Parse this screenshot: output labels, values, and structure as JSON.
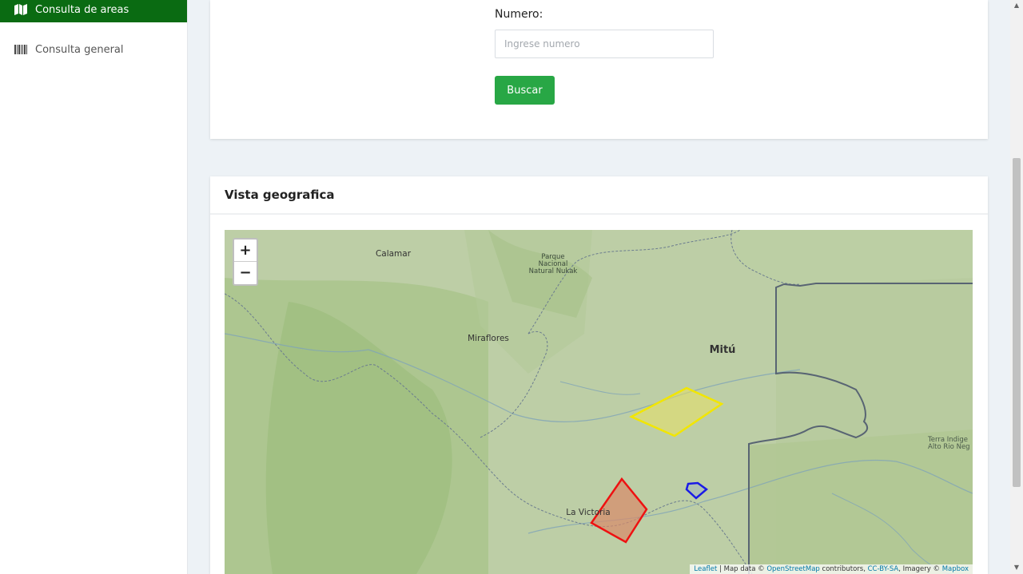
{
  "sidebar": {
    "items": [
      {
        "label": "Consulta de areas",
        "icon": "map-icon",
        "active": true
      },
      {
        "label": "Consulta general",
        "icon": "barcode-icon",
        "active": false
      }
    ]
  },
  "search": {
    "label": "Numero:",
    "placeholder": "Ingrese numero",
    "value": "",
    "button_label": "Buscar"
  },
  "map_card": {
    "title": "Vista geografica",
    "zoom_in": "+",
    "zoom_out": "−",
    "places": [
      "Calamar",
      "Parque",
      "Nacional",
      "Natural Nukak",
      "Miraflores",
      "Mitú",
      "La Victoria",
      "Terra Indige",
      "Alto Rio Neg"
    ],
    "polygons": [
      {
        "name": "yellow-area",
        "color": "#f2e600"
      },
      {
        "name": "red-area",
        "color": "#ee1111"
      },
      {
        "name": "blue-area",
        "color": "#1a1ae6"
      }
    ],
    "attribution": {
      "leaflet": "Leaflet",
      "sep1": " | Map data © ",
      "osm": "OpenStreetMap",
      "contrib": " contributors, ",
      "license": "CC-BY-SA",
      "imagery": ", Imagery © ",
      "mapbox": "Mapbox"
    }
  },
  "colors": {
    "sidebar_active": "#0a6b12",
    "button": "#28a745",
    "page_bg": "#edf2f6"
  }
}
